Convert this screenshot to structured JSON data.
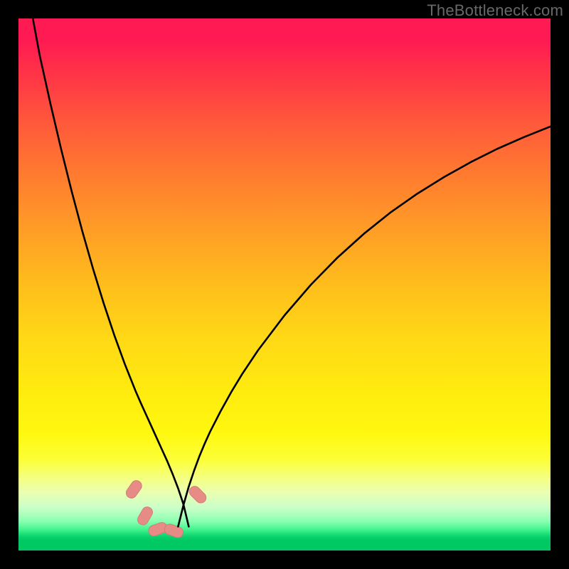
{
  "watermark": {
    "text": "TheBottleneck.com"
  },
  "colors": {
    "frame": "#000000",
    "curve": "#000000",
    "marker": "#e68b86",
    "marker_outline": "#d07a76"
  },
  "chart_data": {
    "type": "line",
    "title": "",
    "xlabel": "",
    "ylabel": "",
    "xlim": [
      0,
      100
    ],
    "ylim": [
      0,
      100
    ],
    "curves": [
      {
        "name": "left-branch",
        "x": [
          2.7,
          4,
          6,
          8,
          10,
          12,
          14,
          16,
          18,
          20,
          21,
          22,
          23,
          24,
          25,
          26,
          27,
          28,
          29,
          30,
          31,
          32
        ],
        "y": [
          100,
          93,
          84,
          75.5,
          67.5,
          60,
          53,
          46.5,
          40.5,
          35,
          32.5,
          30,
          27.7,
          25.5,
          23.3,
          21.1,
          18.9,
          16.7,
          14.3,
          11.7,
          8.7,
          4.5
        ]
      },
      {
        "name": "right-branch",
        "x": [
          30,
          31,
          32,
          33,
          34,
          35,
          36,
          38,
          40,
          42,
          45,
          50,
          55,
          60,
          65,
          70,
          75,
          80,
          85,
          90,
          95,
          100
        ],
        "y": [
          4.5,
          8.5,
          12,
          15,
          17.7,
          20.1,
          22.3,
          26.2,
          29.8,
          33.1,
          37.6,
          44.2,
          50,
          55.1,
          59.6,
          63.6,
          67.1,
          70.2,
          73.0,
          75.5,
          77.7,
          79.7
        ]
      }
    ],
    "markers": {
      "name": "highlight-markers",
      "points": [
        {
          "x": 21.7,
          "y": 11.5,
          "rot": -55
        },
        {
          "x": 23.8,
          "y": 6.5,
          "rot": -60
        },
        {
          "x": 26.2,
          "y": 4.0,
          "rot": -20
        },
        {
          "x": 29.2,
          "y": 3.7,
          "rot": 20
        },
        {
          "x": 33.7,
          "y": 10.5,
          "rot": 45
        }
      ],
      "size": {
        "w": 3.6,
        "h": 2.0,
        "r": 1.0
      }
    }
  }
}
